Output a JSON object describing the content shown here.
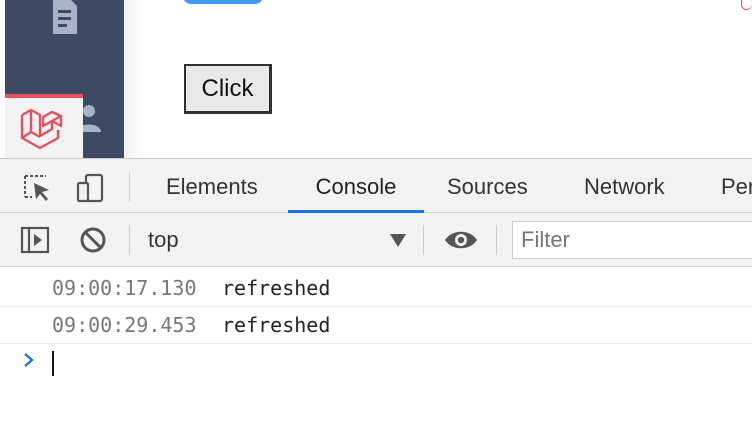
{
  "page": {
    "button_label": "Click"
  },
  "devtools": {
    "tabs": [
      {
        "label": "Elements"
      },
      {
        "label": "Console"
      },
      {
        "label": "Sources"
      },
      {
        "label": "Network"
      },
      {
        "label": "Per"
      }
    ],
    "active_tab": "Console",
    "context": "top",
    "filter_placeholder": "Filter",
    "console_logs": [
      {
        "time": "09:00:17.130",
        "message": "refreshed"
      },
      {
        "time": "09:00:29.453",
        "message": "refreshed"
      }
    ],
    "prompt_symbol": ">"
  },
  "icons": [
    "document-icon",
    "users-icon",
    "laravel-logo-icon",
    "inspect-element-icon",
    "device-toolbar-icon",
    "sidebar-toggle-icon",
    "clear-console-icon",
    "eye-icon",
    "chevron-prompt-icon"
  ],
  "colors": {
    "sidebar": "#3e4a63",
    "accent_blue": "#1a73e8",
    "laravel_red": "#e8505f",
    "devtools_bg": "#f3f3f3"
  }
}
